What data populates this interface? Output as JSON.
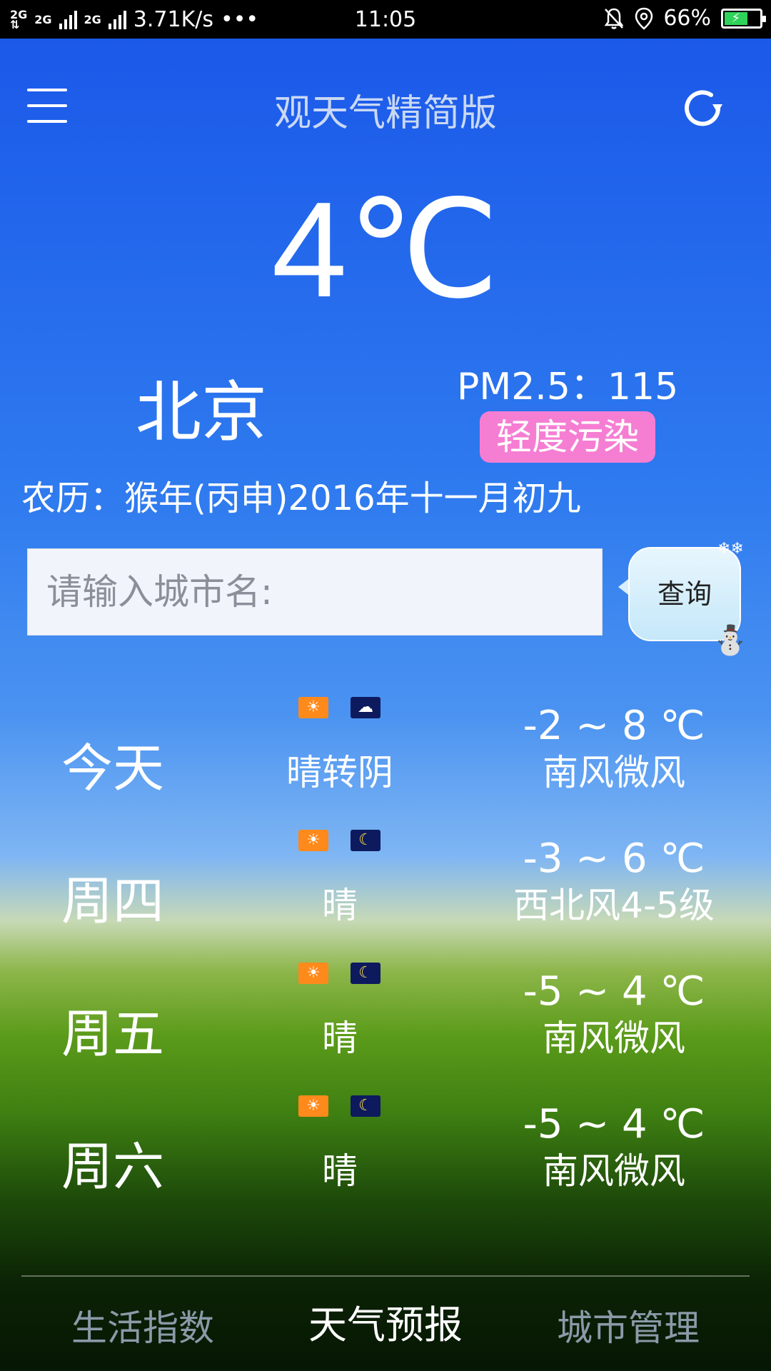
{
  "status_bar": {
    "network_1": "2G",
    "network_2": "2G",
    "network_3": "2G",
    "speed": "3.71K/s",
    "dots": "•••",
    "time": "11:05",
    "battery": "66%"
  },
  "header": {
    "title": "观天气精简版",
    "menu_icon": "hamburger-menu-icon",
    "refresh_icon": "refresh-icon"
  },
  "current": {
    "temperature": "4℃",
    "city": "北京",
    "pm25": "PM2.5：115",
    "pollution_level": "轻度污染",
    "lunar_date": "农历：猴年(丙申)2016年十一月初九"
  },
  "search": {
    "placeholder": "请输入城市名:",
    "value": "",
    "button_label": "查询"
  },
  "forecast": [
    {
      "day": "今天",
      "day_icon": "sun-icon",
      "night_icon": "cloudy-night-icon",
      "condition": "晴转阴",
      "temp_range": "-2 ~ 8 ℃",
      "wind": "南风微风"
    },
    {
      "day": "周四",
      "day_icon": "sun-icon",
      "night_icon": "moon-icon",
      "condition": "晴",
      "temp_range": "-3 ~ 6 ℃",
      "wind": "西北风4-5级"
    },
    {
      "day": "周五",
      "day_icon": "sun-icon",
      "night_icon": "moon-icon",
      "condition": "晴",
      "temp_range": "-5 ~ 4 ℃",
      "wind": "南风微风"
    },
    {
      "day": "周六",
      "day_icon": "sun-icon",
      "night_icon": "moon-icon",
      "condition": "晴",
      "temp_range": "-5 ~ 4 ℃",
      "wind": "南风微风"
    }
  ],
  "tabs": [
    {
      "label": "生活指数",
      "active": false
    },
    {
      "label": "天气预报",
      "active": true
    },
    {
      "label": "城市管理",
      "active": false
    }
  ],
  "colors": {
    "pollution_badge": "#f57ed3",
    "sun_icon_bg": "#ff8a1c",
    "night_icon_bg": "#0d1a5e"
  }
}
